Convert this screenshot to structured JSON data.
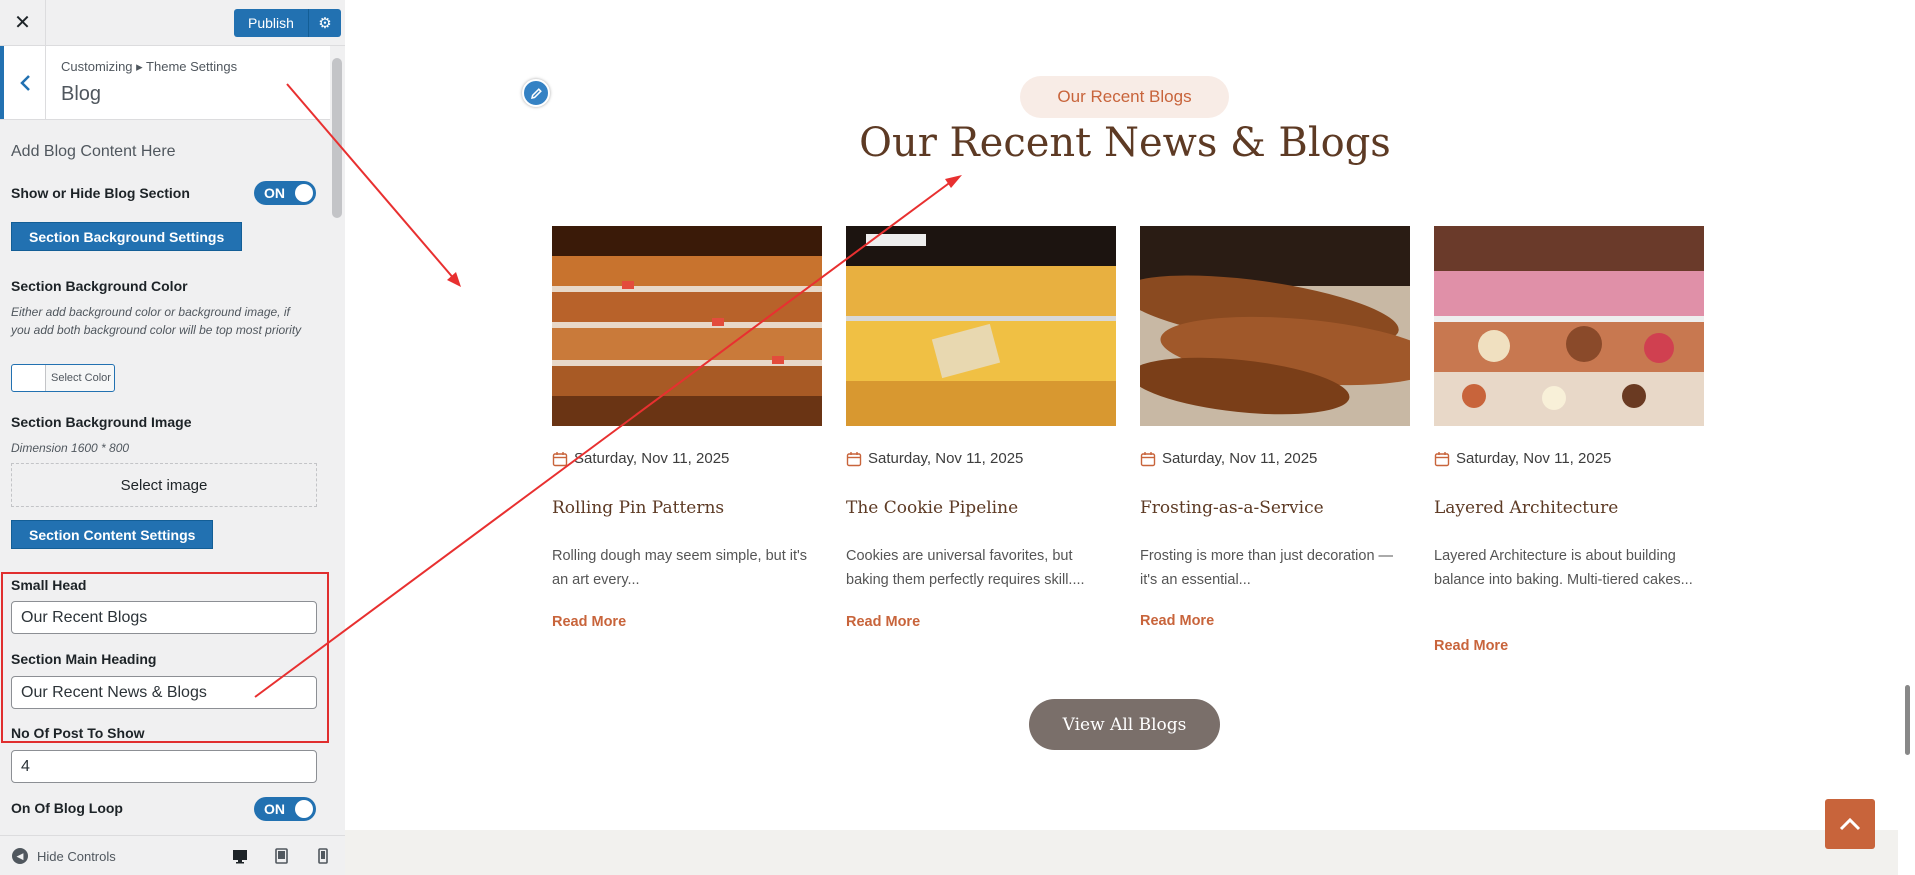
{
  "customizer": {
    "close_icon": "close-icon",
    "publish_label": "Publish",
    "breadcrumb": "Customizing ▸ Theme Settings",
    "section_title": "Blog",
    "add_content_heading": "Add Blog Content Here",
    "show_hide_label": "Show or Hide Blog Section",
    "show_hide_toggle": "ON",
    "bg_settings_button": "Section Background Settings",
    "bg_color_label": "Section Background Color",
    "bg_color_desc": "Either add background color or background image, if you add both background color will be top most priority",
    "select_color_label": "Select Color",
    "bg_image_label": "Section Background Image",
    "bg_image_dimension": "Dimension 1600 * 800",
    "select_image_label": "Select image",
    "content_settings_button": "Section Content Settings",
    "small_head_label": "Small Head",
    "small_head_value": "Our Recent Blogs",
    "main_heading_label": "Section Main Heading",
    "main_heading_value": "Our Recent News & Blogs",
    "posts_count_label": "No Of Post To Show",
    "posts_count_value": "4",
    "blog_loop_label": "On Of Blog Loop",
    "blog_loop_toggle": "ON",
    "hide_controls_label": "Hide Controls",
    "devices": [
      "desktop-icon",
      "tablet-icon",
      "mobile-icon"
    ]
  },
  "preview": {
    "small_head": "Our Recent Blogs",
    "main_heading": "Our Recent News & Blogs",
    "posts": [
      {
        "image": "bakery-shelves-photo",
        "date": "Saturday, Nov 11, 2025",
        "title": "Rolling Pin Patterns",
        "excerpt": "Rolling dough may seem simple, but it's an art every...",
        "link": "Read More"
      },
      {
        "image": "pastry-display-photo",
        "date": "Saturday, Nov 11, 2025",
        "title": "The Cookie Pipeline",
        "excerpt": "Cookies are universal favorites, but baking them perfectly requires skill....",
        "link": "Read More"
      },
      {
        "image": "baguettes-photo",
        "date": "Saturday, Nov 11, 2025",
        "title": "Frosting-as-a-Service",
        "excerpt": "Frosting is more than just decoration — it's an essential...",
        "link": "Read More"
      },
      {
        "image": "cake-display-photo",
        "date": "Saturday, Nov 11, 2025",
        "title": "Layered Architecture",
        "excerpt": "Layered Architecture is about building balance into baking. Multi-tiered cakes...",
        "link": "Read More"
      }
    ],
    "view_all_label": "View All Blogs"
  },
  "colors": {
    "wp_blue": "#2271b1",
    "accent": "#c8643b",
    "heading": "#5d3a24",
    "highlight": "#e02e2e"
  }
}
